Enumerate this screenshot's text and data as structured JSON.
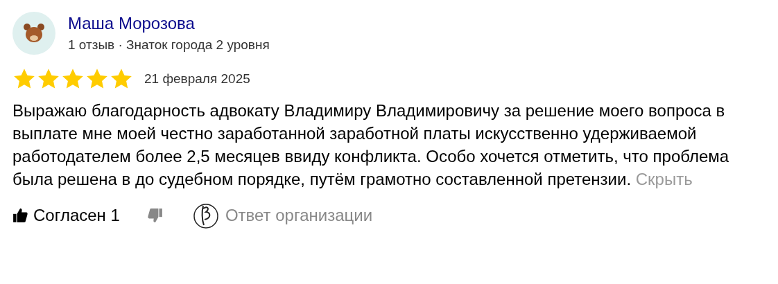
{
  "author": {
    "name": "Маша Морозова",
    "meta": "1 отзыв · Знаток города 2 уровня"
  },
  "review": {
    "stars": 5,
    "date": "21 февраля 2025",
    "text": "Выражаю благодарность адвокату Владимиру Владимировичу за решение моего вопроса в выплате мне моей честно заработанной заработной платы искусственно удерживаемой работодателем более 2,5 месяцев ввиду конфликта. Особо хочется отметить, что проблема была решена в до судебном порядке, путём грамотно составленной претензии.",
    "collapse_link": "Скрыть"
  },
  "actions": {
    "like_label": "Согласен 1",
    "org_reply": "Ответ организации"
  }
}
